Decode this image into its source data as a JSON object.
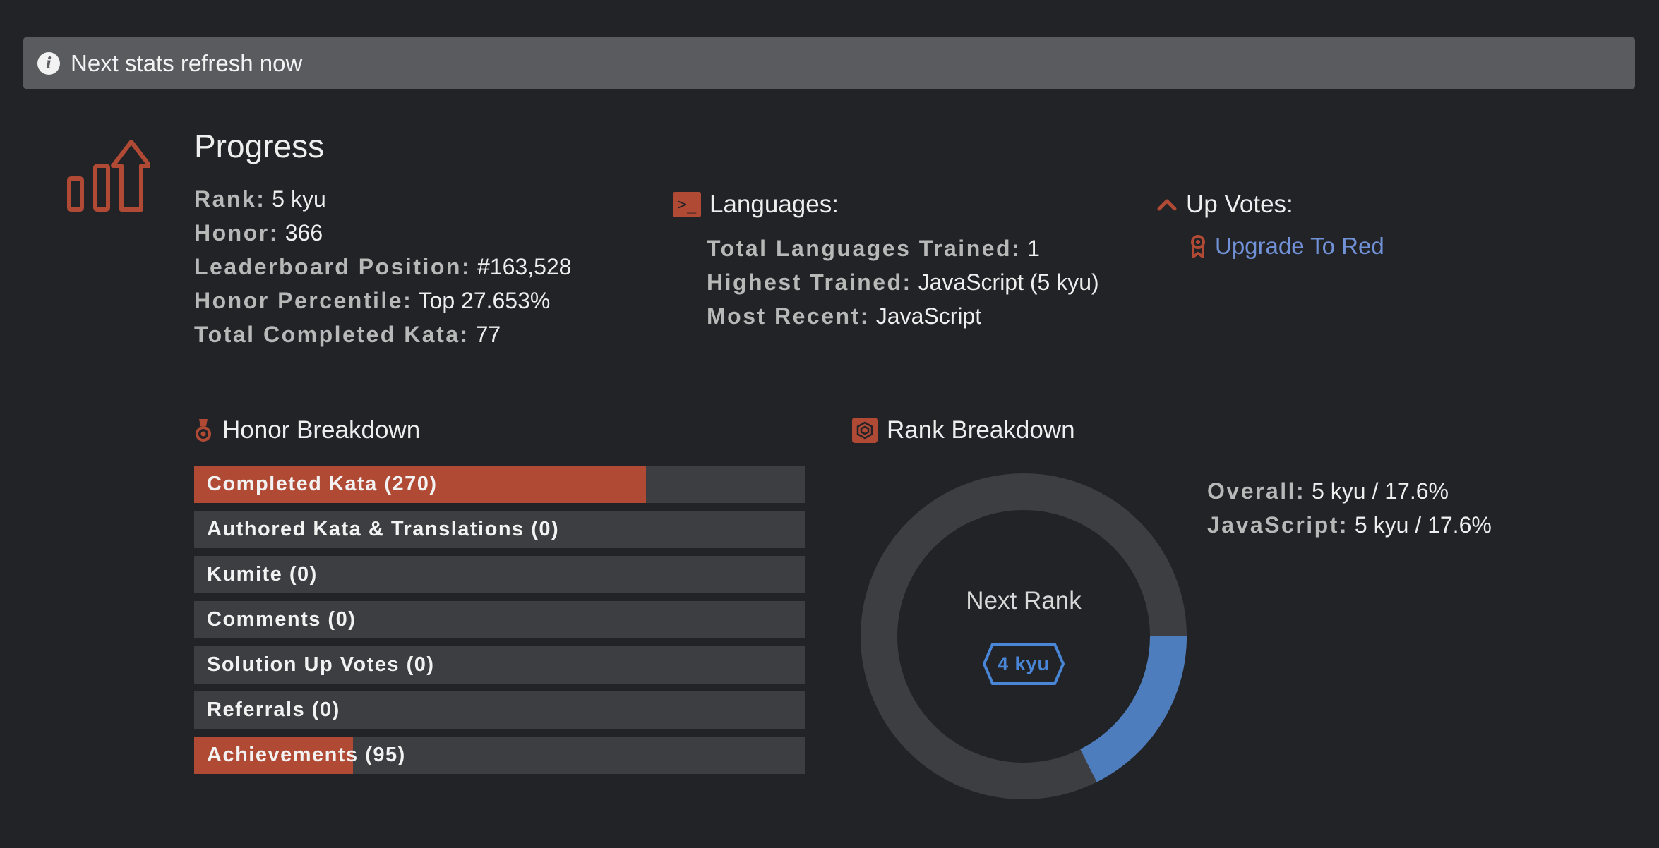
{
  "banner": {
    "text": "Next stats refresh now"
  },
  "progress": {
    "title": "Progress",
    "stats": [
      {
        "label": "Rank:",
        "value": "5 kyu"
      },
      {
        "label": "Honor:",
        "value": "366"
      },
      {
        "label": "Leaderboard Position:",
        "value": "#163,528"
      },
      {
        "label": "Honor Percentile:",
        "value": "Top 27.653%"
      },
      {
        "label": "Total Completed Kata:",
        "value": "77"
      }
    ]
  },
  "languages": {
    "title": "Languages:",
    "icon": "terminal-icon",
    "stats": [
      {
        "label": "Total Languages Trained:",
        "value": "1"
      },
      {
        "label": "Highest Trained:",
        "value": "JavaScript (5 kyu)"
      },
      {
        "label": "Most Recent:",
        "value": "JavaScript"
      }
    ]
  },
  "up_votes": {
    "title": "Up Votes:",
    "link": "Upgrade To Red"
  },
  "honor_breakdown": {
    "title": "Honor Breakdown",
    "bars": [
      {
        "label": "Completed Kata (270)",
        "fill": 0.74
      },
      {
        "label": "Authored Kata & Translations (0)",
        "fill": 0
      },
      {
        "label": "Kumite (0)",
        "fill": 0
      },
      {
        "label": "Comments (0)",
        "fill": 0
      },
      {
        "label": "Solution Up Votes (0)",
        "fill": 0
      },
      {
        "label": "Referrals (0)",
        "fill": 0
      },
      {
        "label": "Achievements (95)",
        "fill": 0.26
      }
    ]
  },
  "rank_breakdown": {
    "title": "Rank Breakdown",
    "progress_fraction": 0.176,
    "center_label": "Next Rank",
    "next_rank": "4 kyu",
    "stats": [
      {
        "label": "Overall:",
        "value": "5 kyu / 17.6%"
      },
      {
        "label": "JavaScript:",
        "value": "5 kyu / 17.6%"
      }
    ]
  },
  "colors": {
    "accent": "#b04a35",
    "rank_blue": "#4a86d8",
    "donut_track": "#3d3e41",
    "link": "#7192d8"
  }
}
